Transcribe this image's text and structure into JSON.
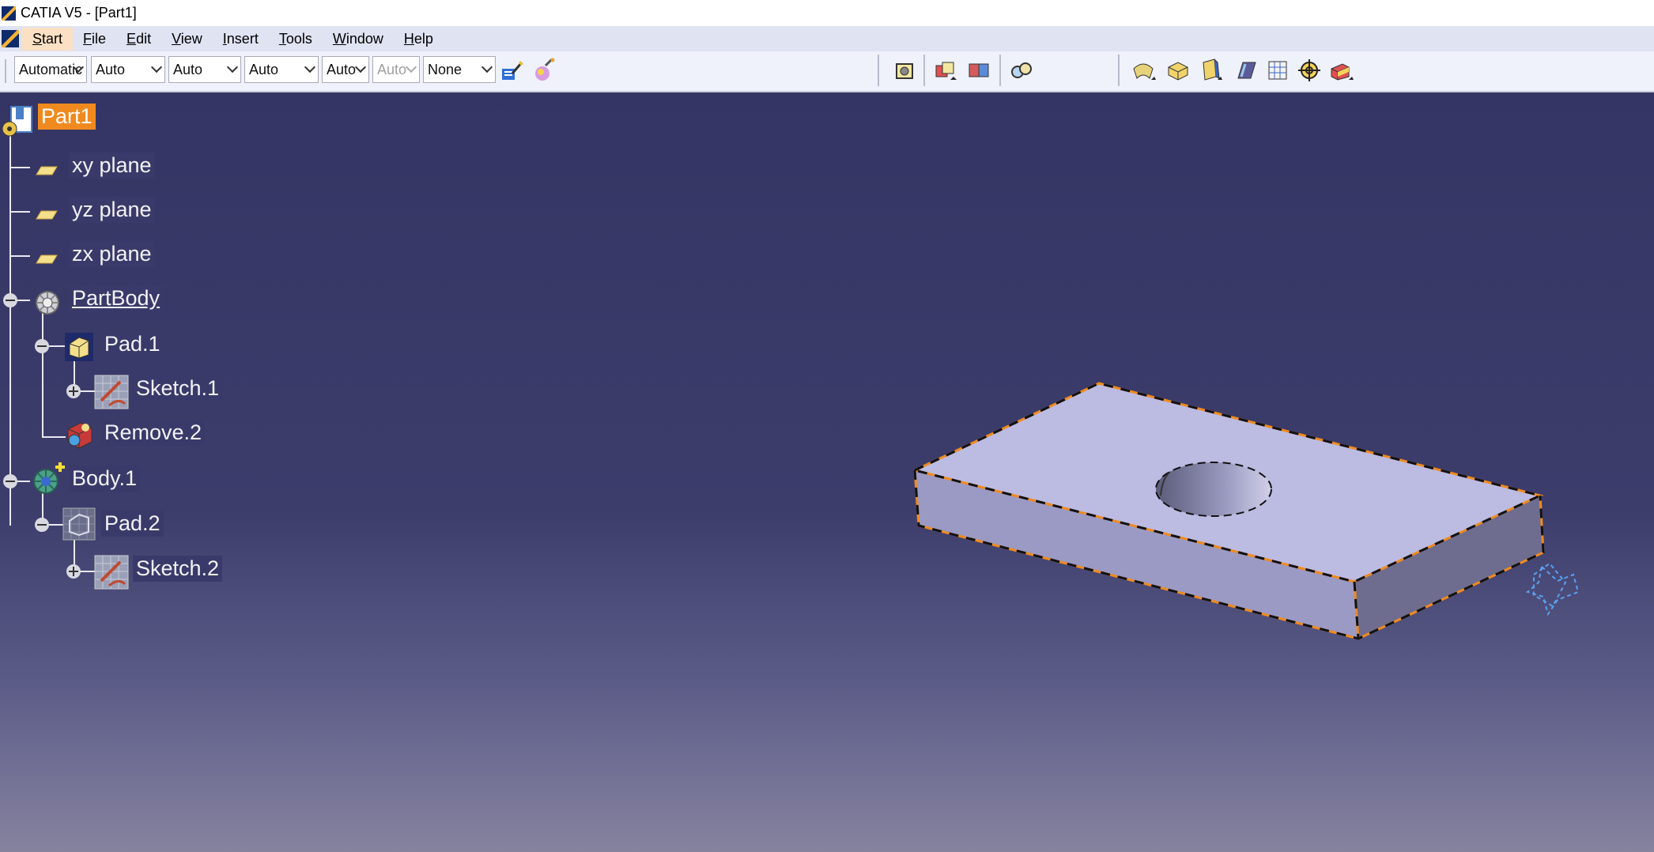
{
  "window": {
    "title": "CATIA V5 - [Part1]"
  },
  "menu": {
    "items": [
      {
        "label": "Start",
        "accel": "S",
        "rest": "tart"
      },
      {
        "label": "File",
        "accel": "F",
        "rest": "ile"
      },
      {
        "label": "Edit",
        "accel": "E",
        "rest": "dit"
      },
      {
        "label": "View",
        "accel": "V",
        "rest": "iew"
      },
      {
        "label": "Insert",
        "accel": "I",
        "rest": "nsert"
      },
      {
        "label": "Tools",
        "accel": "T",
        "rest": "ools"
      },
      {
        "label": "Window",
        "accel": "W",
        "rest": "indow"
      },
      {
        "label": "Help",
        "accel": "H",
        "rest": "elp"
      }
    ]
  },
  "toolbar": {
    "combos": [
      {
        "value": "Automatic",
        "disabled": false
      },
      {
        "value": "Auto",
        "disabled": false
      },
      {
        "value": "Auto",
        "disabled": false
      },
      {
        "value": "Auto",
        "disabled": false
      },
      {
        "value": "Auto",
        "disabled": false
      },
      {
        "value": "Auto",
        "disabled": true
      },
      {
        "value": "None",
        "disabled": false
      }
    ],
    "icons": [
      "painter-icon",
      "paint-bucket-icon",
      "gear-box-icon",
      "multi-box-icon",
      "assembly-icon",
      "link-icon",
      "revolve-icon",
      "pad-icon",
      "pocket-icon",
      "rib-icon",
      "grid-icon",
      "target-icon",
      "shaft-icon"
    ]
  },
  "tree": {
    "root": "Part1",
    "xy": "xy plane",
    "yz": "yz plane",
    "zx": "zx plane",
    "partbody": "PartBody",
    "pad1": "Pad.1",
    "sketch1": "Sketch.1",
    "remove2": "Remove.2",
    "body1": "Body.1",
    "pad2": "Pad.2",
    "sketch2": "Sketch.2"
  },
  "colors": {
    "selection": "#f08a1e",
    "viewport_top": "#353565",
    "viewport_bottom": "#86839f",
    "part_top": "#bcbbe2",
    "part_front": "#9b9ac4",
    "part_side": "#6e6d90"
  }
}
